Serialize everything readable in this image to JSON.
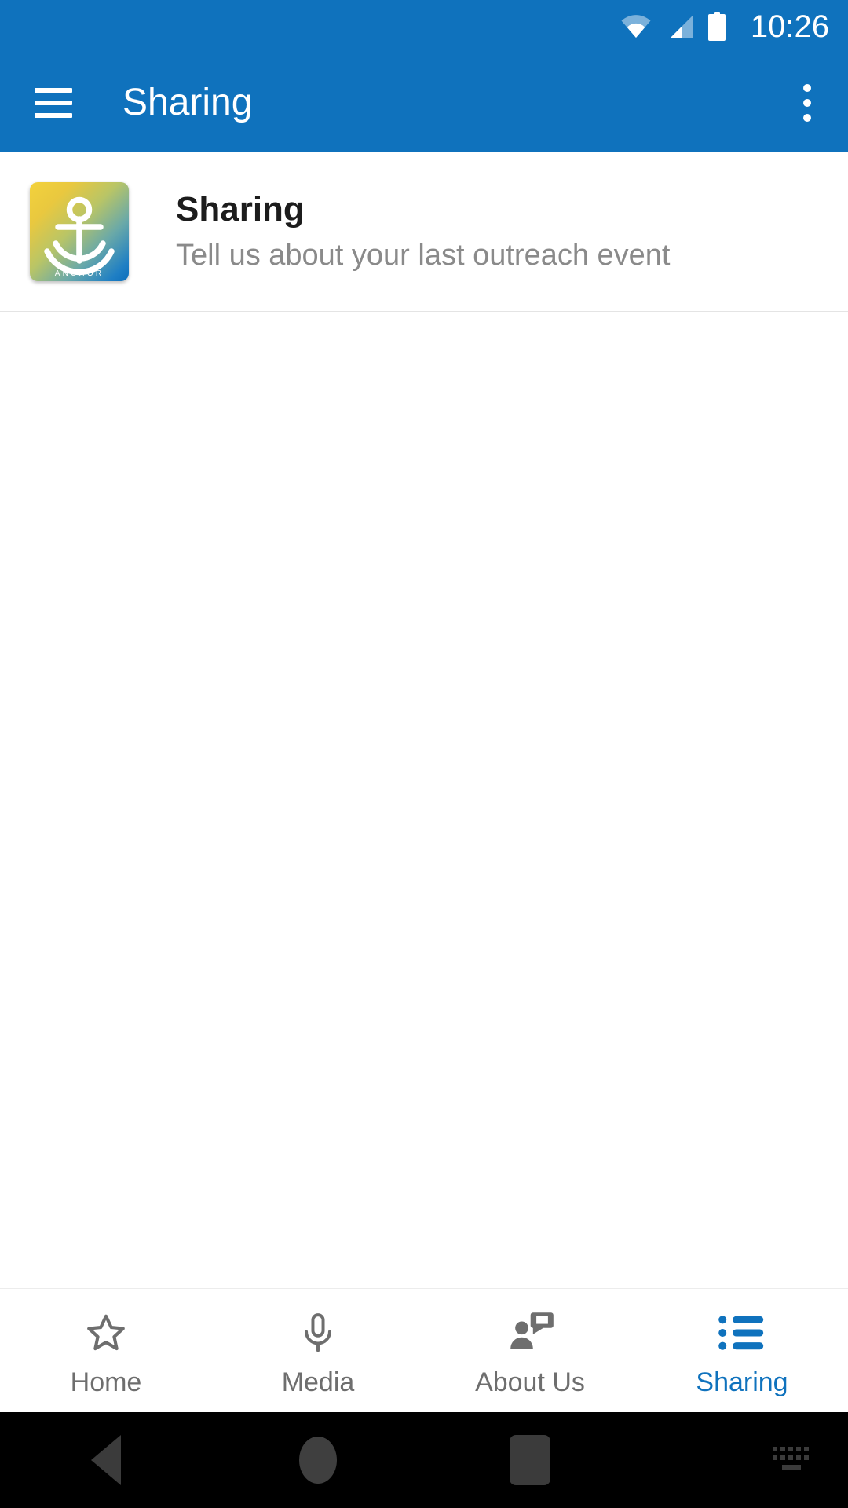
{
  "status_bar": {
    "time": "10:26",
    "icons": [
      "wifi-icon",
      "cellular-signal-icon",
      "battery-icon"
    ],
    "background_color": "#0f72bd",
    "foreground_color": "#ffffff"
  },
  "app_bar": {
    "menu_icon": "hamburger-menu-icon",
    "title": "Sharing",
    "overflow_icon": "more-vertical-icon",
    "background_color": "#0f72bd"
  },
  "list": {
    "items": [
      {
        "thumbnail_icon": "anchor-logo-icon",
        "thumbnail_caption": "ANCHOR",
        "title": "Sharing",
        "subtitle": "Tell us about your last outreach event"
      }
    ]
  },
  "tab_bar": {
    "active_color": "#0f72bd",
    "inactive_color": "#6e6e6e",
    "tabs": [
      {
        "label": "Home",
        "icon": "star-outline-icon",
        "active": false
      },
      {
        "label": "Media",
        "icon": "microphone-icon",
        "active": false
      },
      {
        "label": "About Us",
        "icon": "person-speech-bubble-icon",
        "active": false
      },
      {
        "label": "Sharing",
        "icon": "bulleted-list-icon",
        "active": true
      }
    ]
  },
  "system_nav": {
    "buttons": [
      {
        "name": "back-button",
        "icon": "triangle-back-icon"
      },
      {
        "name": "home-button",
        "icon": "circle-home-icon"
      },
      {
        "name": "recents-button",
        "icon": "square-recents-icon"
      },
      {
        "name": "keyboard-button",
        "icon": "keyboard-icon"
      }
    ],
    "background_color": "#000000"
  }
}
